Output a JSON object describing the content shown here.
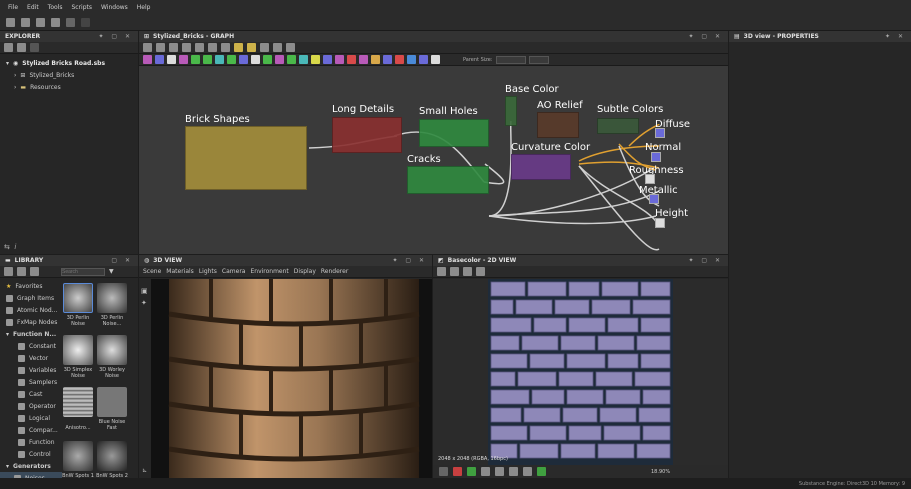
{
  "menu": [
    "File",
    "Edit",
    "Tools",
    "Scripts",
    "Windows",
    "Help"
  ],
  "explorer": {
    "title": "EXPLORER",
    "package": "Stylized Bricks Road.sbs",
    "graph": "Stylized_Bricks",
    "resources": "Resources"
  },
  "graph_panel": {
    "title": "Stylized_Bricks - GRAPH",
    "parent_size_label": "Parent Size:",
    "frames": {
      "brick_shapes": "Brick Shapes",
      "long_details": "Long Details",
      "small_holes": "Small Holes",
      "cracks": "Cracks",
      "base_color": "Base Color",
      "ao_relief": "AO Relief",
      "subtle_colors": "Subtle Colors",
      "curvature_color": "Curvature Color"
    },
    "outputs": [
      "Diffuse",
      "Normal",
      "Roughness",
      "Metallic",
      "Height"
    ]
  },
  "properties": {
    "title": "3D view - PROPERTIES"
  },
  "library": {
    "title": "LIBRARY",
    "search_placeholder": "Search",
    "categories": [
      "Favorites",
      "Graph Items",
      "Atomic Nod...",
      "FxMap Nodes",
      "Function N..."
    ],
    "function_items": [
      "Constant",
      "Vector",
      "Variables",
      "Samplers",
      "Cast",
      "Operator",
      "Logical",
      "Compar...",
      "Function",
      "Control"
    ],
    "generators": "Generators",
    "noises": "Noises",
    "thumbs": [
      "3D Perlin Noise",
      "3D Perlin Noise...",
      "3D Simplex Noise",
      "3D Worley Noise",
      "Anisotro...",
      "Blue Noise Fast",
      "BnW Spots 1",
      "BnW Spots 2"
    ]
  },
  "view3d": {
    "title": "3D VIEW",
    "menu": [
      "Scene",
      "Materials",
      "Lights",
      "Camera",
      "Environment",
      "Display",
      "Renderer"
    ]
  },
  "view2d": {
    "title": "Basecolor - 2D VIEW",
    "resolution": "2048 x 2048 (RGBA, 16bpc)",
    "zoom": "18.90%"
  },
  "status": {
    "text": "Substance Engine: Direct3D 10  Memory: 9"
  },
  "colors": {
    "brick": "#8e88b8",
    "mortar": "#1e2b3a",
    "frame_yellow": "#a58f3a",
    "frame_red": "#8a2f2f",
    "frame_green": "#2f8a3f",
    "frame_orange": "#a06a2a",
    "frame_purple": "#6a3a8a"
  }
}
